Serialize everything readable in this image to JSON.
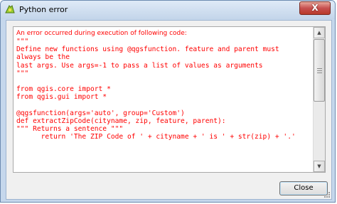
{
  "window": {
    "title": "Python error",
    "close_glyph": "X",
    "icon": "python-error-icon"
  },
  "message": {
    "header": "An error occurred during execution of following code:",
    "code_lines": [
      "\"\"\"",
      "Define new functions using @qgsfunction. feature and parent must",
      "always be the",
      "last args. Use args=-1 to pass a list of values as arguments",
      "\"\"\"",
      "",
      "from qgis.core import *",
      "from qgis.gui import *",
      "",
      "@qgsfunction(args='auto', group='Custom')",
      "def extractZipCode(cityname, zip, feature, parent):",
      "\"\"\" Returns a sentence \"\"\"",
      "      return 'The ZIP Code of ' + cityname + ' is ' + str(zip) + '.'"
    ],
    "text_color": "#ff0000"
  },
  "footer": {
    "close_label": "Close"
  },
  "colors": {
    "frame": "#c5d7ec",
    "close_x": "#c75050"
  }
}
